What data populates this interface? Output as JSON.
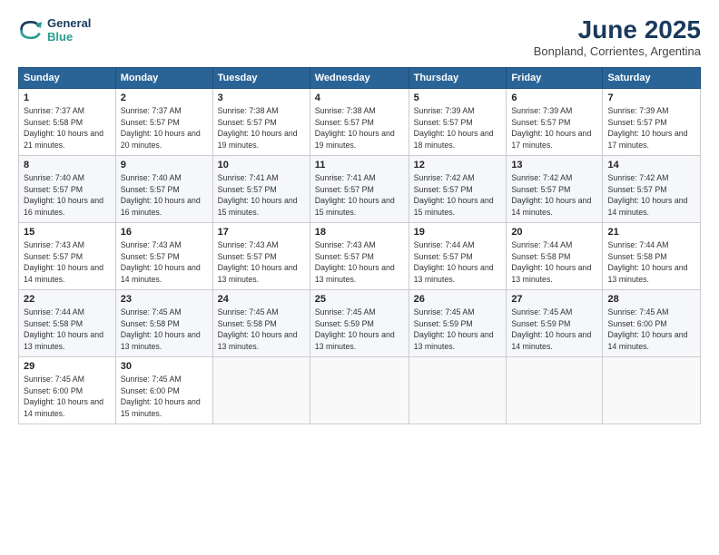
{
  "header": {
    "logo_line1": "General",
    "logo_line2": "Blue",
    "month_year": "June 2025",
    "location": "Bonpland, Corrientes, Argentina"
  },
  "days_of_week": [
    "Sunday",
    "Monday",
    "Tuesday",
    "Wednesday",
    "Thursday",
    "Friday",
    "Saturday"
  ],
  "weeks": [
    [
      {
        "day": "1",
        "sunrise": "7:37 AM",
        "sunset": "5:58 PM",
        "daylight": "10 hours and 21 minutes."
      },
      {
        "day": "2",
        "sunrise": "7:37 AM",
        "sunset": "5:57 PM",
        "daylight": "10 hours and 20 minutes."
      },
      {
        "day": "3",
        "sunrise": "7:38 AM",
        "sunset": "5:57 PM",
        "daylight": "10 hours and 19 minutes."
      },
      {
        "day": "4",
        "sunrise": "7:38 AM",
        "sunset": "5:57 PM",
        "daylight": "10 hours and 19 minutes."
      },
      {
        "day": "5",
        "sunrise": "7:39 AM",
        "sunset": "5:57 PM",
        "daylight": "10 hours and 18 minutes."
      },
      {
        "day": "6",
        "sunrise": "7:39 AM",
        "sunset": "5:57 PM",
        "daylight": "10 hours and 17 minutes."
      },
      {
        "day": "7",
        "sunrise": "7:39 AM",
        "sunset": "5:57 PM",
        "daylight": "10 hours and 17 minutes."
      }
    ],
    [
      {
        "day": "8",
        "sunrise": "7:40 AM",
        "sunset": "5:57 PM",
        "daylight": "10 hours and 16 minutes."
      },
      {
        "day": "9",
        "sunrise": "7:40 AM",
        "sunset": "5:57 PM",
        "daylight": "10 hours and 16 minutes."
      },
      {
        "day": "10",
        "sunrise": "7:41 AM",
        "sunset": "5:57 PM",
        "daylight": "10 hours and 15 minutes."
      },
      {
        "day": "11",
        "sunrise": "7:41 AM",
        "sunset": "5:57 PM",
        "daylight": "10 hours and 15 minutes."
      },
      {
        "day": "12",
        "sunrise": "7:42 AM",
        "sunset": "5:57 PM",
        "daylight": "10 hours and 15 minutes."
      },
      {
        "day": "13",
        "sunrise": "7:42 AM",
        "sunset": "5:57 PM",
        "daylight": "10 hours and 14 minutes."
      },
      {
        "day": "14",
        "sunrise": "7:42 AM",
        "sunset": "5:57 PM",
        "daylight": "10 hours and 14 minutes."
      }
    ],
    [
      {
        "day": "15",
        "sunrise": "7:43 AM",
        "sunset": "5:57 PM",
        "daylight": "10 hours and 14 minutes."
      },
      {
        "day": "16",
        "sunrise": "7:43 AM",
        "sunset": "5:57 PM",
        "daylight": "10 hours and 14 minutes."
      },
      {
        "day": "17",
        "sunrise": "7:43 AM",
        "sunset": "5:57 PM",
        "daylight": "10 hours and 13 minutes."
      },
      {
        "day": "18",
        "sunrise": "7:43 AM",
        "sunset": "5:57 PM",
        "daylight": "10 hours and 13 minutes."
      },
      {
        "day": "19",
        "sunrise": "7:44 AM",
        "sunset": "5:57 PM",
        "daylight": "10 hours and 13 minutes."
      },
      {
        "day": "20",
        "sunrise": "7:44 AM",
        "sunset": "5:58 PM",
        "daylight": "10 hours and 13 minutes."
      },
      {
        "day": "21",
        "sunrise": "7:44 AM",
        "sunset": "5:58 PM",
        "daylight": "10 hours and 13 minutes."
      }
    ],
    [
      {
        "day": "22",
        "sunrise": "7:44 AM",
        "sunset": "5:58 PM",
        "daylight": "10 hours and 13 minutes."
      },
      {
        "day": "23",
        "sunrise": "7:45 AM",
        "sunset": "5:58 PM",
        "daylight": "10 hours and 13 minutes."
      },
      {
        "day": "24",
        "sunrise": "7:45 AM",
        "sunset": "5:58 PM",
        "daylight": "10 hours and 13 minutes."
      },
      {
        "day": "25",
        "sunrise": "7:45 AM",
        "sunset": "5:59 PM",
        "daylight": "10 hours and 13 minutes."
      },
      {
        "day": "26",
        "sunrise": "7:45 AM",
        "sunset": "5:59 PM",
        "daylight": "10 hours and 13 minutes."
      },
      {
        "day": "27",
        "sunrise": "7:45 AM",
        "sunset": "5:59 PM",
        "daylight": "10 hours and 14 minutes."
      },
      {
        "day": "28",
        "sunrise": "7:45 AM",
        "sunset": "6:00 PM",
        "daylight": "10 hours and 14 minutes."
      }
    ],
    [
      {
        "day": "29",
        "sunrise": "7:45 AM",
        "sunset": "6:00 PM",
        "daylight": "10 hours and 14 minutes."
      },
      {
        "day": "30",
        "sunrise": "7:45 AM",
        "sunset": "6:00 PM",
        "daylight": "10 hours and 15 minutes."
      },
      null,
      null,
      null,
      null,
      null
    ]
  ]
}
